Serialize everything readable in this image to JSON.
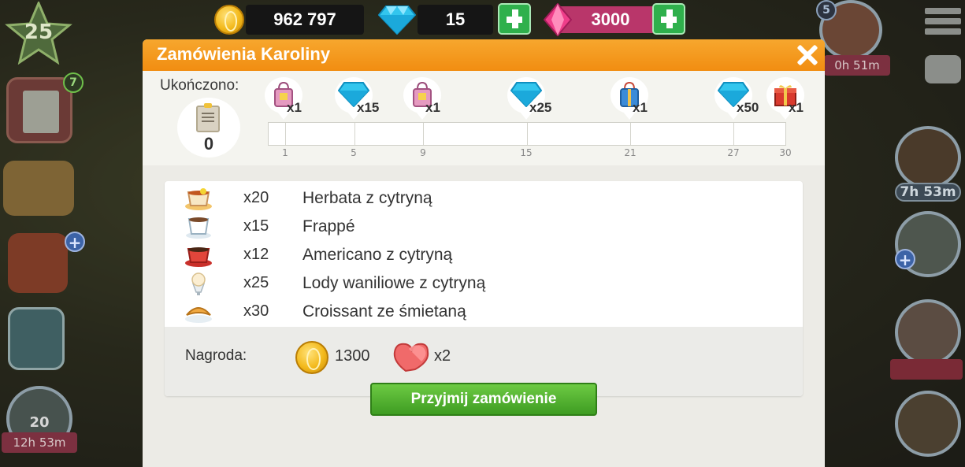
{
  "hud": {
    "coins": "962 797",
    "gems": "15",
    "rubies": "3000",
    "level": "25",
    "task_badge": "7",
    "side_timer_top": "0h 51m",
    "side_badge_top": "5",
    "side_timer_mid": "7h 53m",
    "bottom_left_count": "20",
    "bottom_left_timer": "12h 53m"
  },
  "dialog": {
    "title": "Zamówienia Karoliny",
    "completed_label": "Ukończono:",
    "completed_value": "0",
    "milestones": [
      {
        "icon": "shopping-bag-icon",
        "qty": "x1",
        "day": "1"
      },
      {
        "icon": "diamond-icon",
        "qty": "x15",
        "day": "5"
      },
      {
        "icon": "shopping-bag-icon",
        "qty": "x1",
        "day": "9"
      },
      {
        "icon": "diamond-icon",
        "qty": "x25",
        "day": "15"
      },
      {
        "icon": "blue-gift-bag-icon",
        "qty": "x1",
        "day": "21"
      },
      {
        "icon": "diamond-icon",
        "qty": "x50",
        "day": "27"
      },
      {
        "icon": "gift-box-icon",
        "qty": "x1",
        "day": "30"
      }
    ],
    "orders": [
      {
        "icon": "lemon-tea-icon",
        "qty": "x20",
        "name": "Herbata z cytryną"
      },
      {
        "icon": "frappe-icon",
        "qty": "x15",
        "name": "Frappé"
      },
      {
        "icon": "americano-icon",
        "qty": "x12",
        "name": "Americano z cytryną"
      },
      {
        "icon": "vanilla-ice-cream-icon",
        "qty": "x25",
        "name": "Lody waniliowe z cytryną"
      },
      {
        "icon": "croissant-icon",
        "qty": "x30",
        "name": "Croissant ze śmietaną"
      }
    ],
    "reward": {
      "label": "Nagroda:",
      "coins": "1300",
      "hearts_qty": "x2"
    },
    "accept_label": "Przyjmij zamówienie"
  },
  "colors": {
    "header_orange": "#f18d11",
    "accept_green": "#3e9c22",
    "ruby_pink": "#b9366a",
    "plus_green": "#2fb04c"
  }
}
